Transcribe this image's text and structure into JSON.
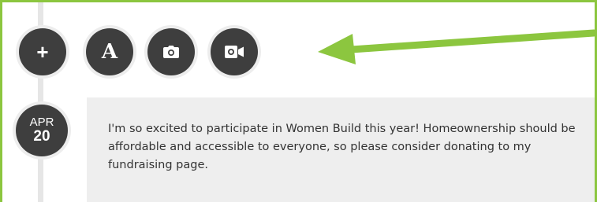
{
  "toolbar": {
    "add_label": "+",
    "text_label": "A",
    "add_icon": "plus-icon",
    "text_icon": "text-format-icon",
    "photo_icon": "camera-icon",
    "video_icon": "video-camera-icon"
  },
  "annotation": {
    "arrow_icon": "arrow-left-icon",
    "arrow_color": "#8cc63f"
  },
  "post": {
    "date_month": "APR",
    "date_day": "20",
    "text": "I'm so excited to participate in Women Build this year! Homeownership should be affordable and accessible to everyone, so please consider donating to my fundraising page."
  },
  "colors": {
    "frame_border": "#8cc63f",
    "button_bg": "#3e3e3e",
    "card_bg": "#eeeeee",
    "timeline": "#e6e6e6"
  }
}
